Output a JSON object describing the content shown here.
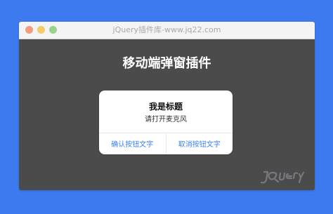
{
  "window": {
    "title": "jQuery插件库-www.jq22.com"
  },
  "page": {
    "heading": "移动端弹窗插件"
  },
  "modal": {
    "title": "我是标题",
    "message": "请打开麦克风",
    "confirm_label": "确认按钮文字",
    "cancel_label": "取消按钮文字"
  },
  "colors": {
    "background": "#3d7af0",
    "window_content": "#4b4b4b",
    "modal_background": "#ffffff",
    "button_text": "#3b82f6"
  },
  "icons": {
    "close": "close-icon",
    "minimize": "minimize-icon",
    "maximize": "maximize-icon",
    "watermark": "jquery-watermark-icon"
  }
}
